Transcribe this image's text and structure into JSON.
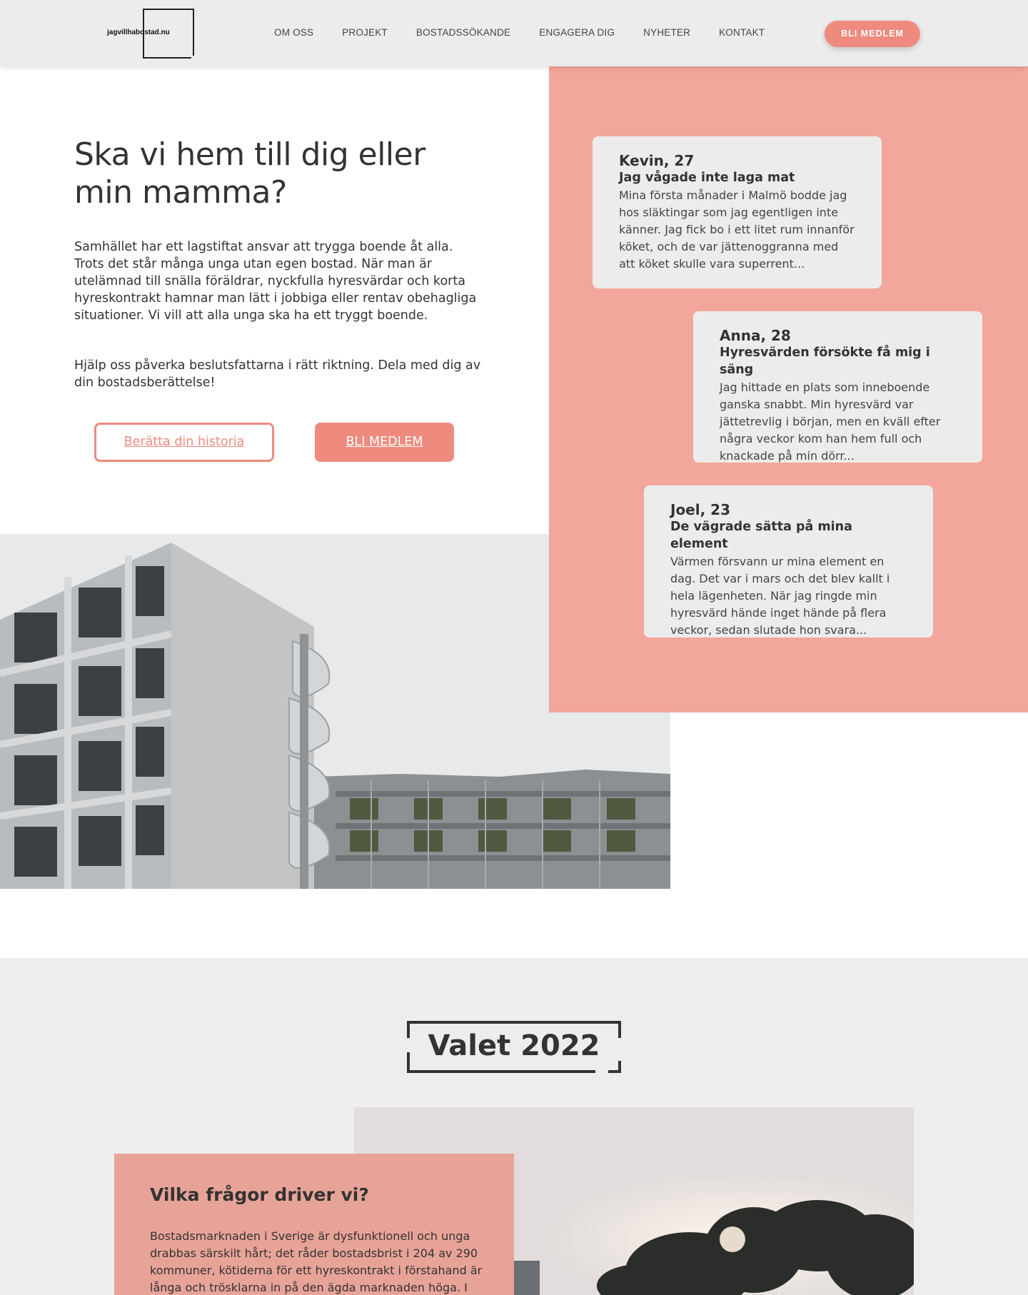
{
  "header": {
    "logo_text": "jagvillhabostad.nu",
    "nav": [
      "OM OSS",
      "PROJEKT",
      "BOSTADSSÖKANDE",
      "ENGAGERA DIG",
      "NYHETER",
      "KONTAKT"
    ],
    "cta_label": "BLI MEDLEM"
  },
  "hero": {
    "title": "Ska vi hem till dig eller min mamma?",
    "paragraph1": "Samhället har ett lagstiftat ansvar att trygga boende åt alla. Trots det står många unga utan egen bostad. När man är utelämnad till snälla föräldrar, nyckfulla hyresvärdar och korta hyreskontrakt hamnar man lätt i jobbiga eller rentav obehagliga situationer. Vi vill att alla unga ska ha ett tryggt boende.",
    "paragraph2": "Hjälp oss påverka beslutsfattarna i rätt riktning. Dela med dig av din bostadsberättelse!",
    "btn_story": "Berätta din historia",
    "btn_member": "BLI MEDLEM"
  },
  "stories": [
    {
      "name": "Kevin, 27",
      "headline": "Jag vågade inte laga mat",
      "body": "Mina första månader i Malmö bodde jag hos släktingar som jag egentligen inte känner. Jag fick bo i ett litet rum innanför köket, och de var jättenoggranna med att köket skulle vara superrent..."
    },
    {
      "name": "Anna, 28",
      "headline": "Hyresvärden försökte få mig i säng",
      "body": "Jag hittade en plats som inneboende ganska snabbt. Min hyresvärd var jättetrevlig i början, men en kväll efter några veckor kom han hem full och knackade på min dörr..."
    },
    {
      "name": "Joel, 23",
      "headline": "De vägrade sätta på mina element",
      "body": "Värmen försvann ur mina element en dag. Det var i mars och det blev kallt i hela lägenheten. När jag ringde min hyresvärd  hände inget hände på flera veckor, sedan slutade hon svara..."
    }
  ],
  "election": {
    "title": "Valet 2022",
    "issue_title": "Vilka frågor driver vi?",
    "issue_text": "Bostadsmarknaden i Sverige är dysfunktionell och unga drabbas särskilt hårt; det råder bostadsbrist i 204 av 290 kommuner, kötiderna för ett hyreskontrakt i förstahand är långa och trösklarna in på den ägda marknaden höga. I"
  },
  "colors": {
    "accent": "#ee8b7e",
    "panel": "#f3a69b",
    "card": "#ececec"
  }
}
